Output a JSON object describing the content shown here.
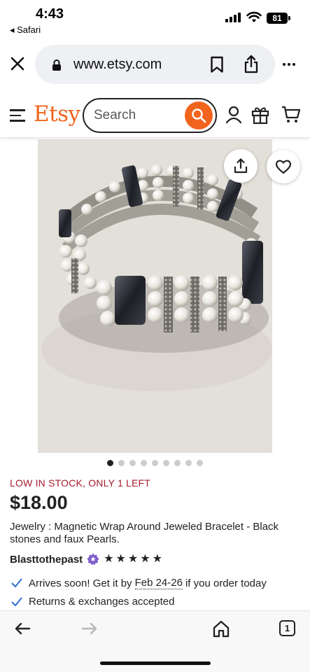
{
  "status_bar": {
    "time": "4:43",
    "back_app": "◂ Safari",
    "battery": "81"
  },
  "browser": {
    "url": "www.etsy.com"
  },
  "etsy_header": {
    "logo": "Etsy",
    "search_placeholder": "Search"
  },
  "product": {
    "image_alt": "Magnetic wrap bracelet with black hematite stones and faux pearls",
    "image_count": 9,
    "active_image": 1,
    "stock_notice": "LOW IN STOCK, ONLY 1 LEFT",
    "price": "$18.00",
    "title": "Jewelry : Magnetic Wrap Around Jeweled Bracelet - Black stones and faux Pearls.",
    "shop_name": "Blasttothepast",
    "rating_stars": 5,
    "features": {
      "arrival_prefix": "Arrives soon! Get it by",
      "arrival_dates": "Feb 24-26",
      "arrival_suffix": "if you order today",
      "returns": "Returns & exchanges accepted"
    }
  },
  "toolbar": {
    "tab_count": "1"
  },
  "colors": {
    "etsy_orange": "#f1641e",
    "stock_red": "#a61a2e",
    "check_blue": "#2f6fd1"
  }
}
